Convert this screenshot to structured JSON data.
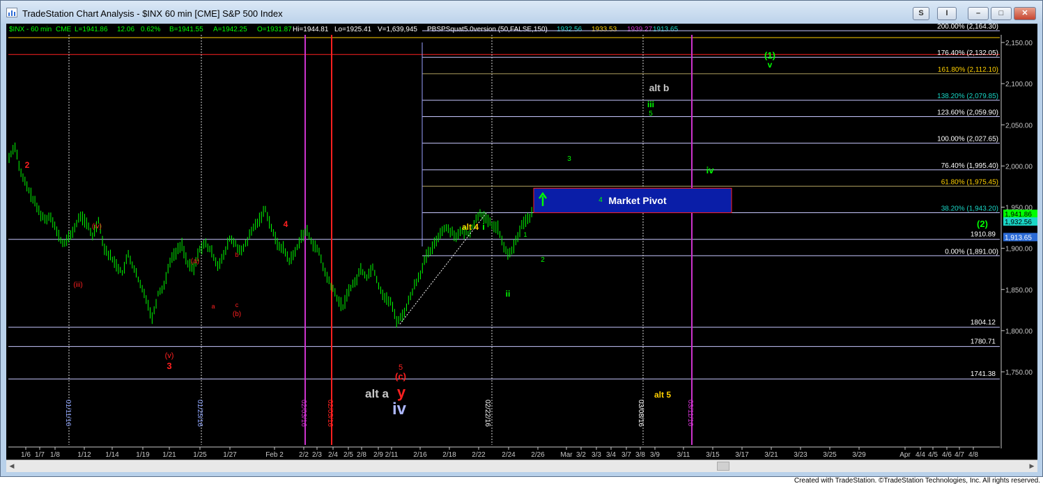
{
  "window": {
    "title": "TradeStation Chart Analysis - $INX 60 min [CME] S&P 500 Index",
    "buttons": {
      "s": "S",
      "i": "I",
      "minimize": "–",
      "maximize": "□",
      "close": "✕"
    }
  },
  "status_bar": {
    "symbol": "$INX - 60 min",
    "exchange": "CME",
    "last": "L=1941.86",
    "change": "12.06",
    "pct": "0.62%",
    "bid": "B=1941.55",
    "ask": "A=1942.25",
    "open": "O=1931.87",
    "high": "Hi=1944.81",
    "low": "Lo=1925.41",
    "volume": "V=1,639,945",
    "indicator": "PBSPSquat5.0version (50,FALSE,150)",
    "ind1": "1932.56",
    "ind2": "1933.53",
    "ind3": "1939.27",
    "ind4": "1913.65"
  },
  "colors": {
    "green": "#00ff00",
    "red": "#ff2020",
    "magenta": "#cc33cc",
    "yellow": "#ffd000",
    "teal": "#19d6c6"
  },
  "chart_data": {
    "type": "line",
    "title": "$INX 60 min [CME] S&P 500 Index",
    "price_axis_ticks": [
      "2,150.00",
      "2,100.00",
      "2,050.00",
      "2,000.00",
      "1,950.00",
      "1,900.00",
      "1,850.00",
      "1,800.00",
      "1,750.00"
    ],
    "price_axis_values": [
      2150,
      2100,
      2050,
      2000,
      1950,
      1900,
      1850,
      1800,
      1750
    ],
    "ylim": [
      1730,
      2168
    ],
    "date_labels": [
      "1/6",
      "1/7",
      "1/8",
      "1/12",
      "1/14",
      "1/19",
      "1/21",
      "1/25",
      "1/27",
      "Feb 2",
      "2/2",
      "2/3",
      "2/4",
      "2/5",
      "2/8",
      "2/9",
      "2/11",
      "2/16",
      "2/18",
      "2/22",
      "2/24",
      "2/26",
      "Mar",
      "3/2",
      "3/3",
      "3/4",
      "3/7",
      "3/8",
      "3/9",
      "3/11",
      "3/15",
      "3/17",
      "3/21",
      "3/23",
      "3/25",
      "3/29",
      "Apr",
      "4/4",
      "4/5",
      "4/6",
      "4/7",
      "4/8"
    ],
    "price_path": [
      2010,
      2025,
      1990,
      1975,
      1960,
      1945,
      1935,
      1940,
      1920,
      1905,
      1912,
      1925,
      1940,
      1930,
      1915,
      1935,
      1900,
      1890,
      1880,
      1870,
      1892,
      1875,
      1855,
      1840,
      1815,
      1845,
      1855,
      1885,
      1895,
      1905,
      1880,
      1875,
      1900,
      1905,
      1895,
      1880,
      1890,
      1912,
      1905,
      1895,
      1910,
      1925,
      1935,
      1948,
      1925,
      1905,
      1900,
      1885,
      1895,
      1915,
      1920,
      1905,
      1895,
      1870,
      1855,
      1840,
      1828,
      1850,
      1858,
      1875,
      1865,
      1878,
      1855,
      1840,
      1835,
      1812,
      1818,
      1835,
      1855,
      1870,
      1890,
      1900,
      1915,
      1925,
      1922,
      1915,
      1920,
      1918,
      1930,
      1944,
      1935,
      1928,
      1925,
      1900,
      1892,
      1908,
      1928,
      1936,
      1944
    ],
    "fib_levels": [
      {
        "label": "200.00% (2,164.30)",
        "value": 2164.3
      },
      {
        "label": "176.40% (2,132.05)",
        "value": 2132.05
      },
      {
        "label": "161.80% (2,112.10)",
        "value": 2112.1
      },
      {
        "label": "138.20% (2,079.85)",
        "value": 2079.85
      },
      {
        "label": "123.60% (2,059.90)",
        "value": 2059.9
      },
      {
        "label": "100.00% (2,027.65)",
        "value": 2027.65
      },
      {
        "label": "76.40% (1,995.40)",
        "value": 1995.4
      },
      {
        "label": "61.80% (1,975.45)",
        "value": 1975.45
      },
      {
        "label": "38.20% (1,943.20)",
        "value": 1943.2
      },
      {
        "label": "0.00% (1,891.00)",
        "value": 1891.0
      }
    ],
    "h_levels": [
      {
        "label": "1910.89",
        "value": 1910.89
      },
      {
        "label": "1804.12",
        "value": 1804.12
      },
      {
        "label": "1780.71",
        "value": 1780.71
      },
      {
        "label": "1741.38",
        "value": 1741.38
      }
    ],
    "price_tags": [
      {
        "label": "1,941.86",
        "value": 1941.86
      },
      {
        "label": "1,932.56",
        "value": 1932.56
      },
      {
        "label": "1,913.65",
        "value": 1913.65
      }
    ],
    "vertical_date_labels": [
      "01/11/16",
      "01/25/16",
      "02/03/16",
      "02/05/16",
      "02/22/16",
      "03/08/16",
      "03/11/16"
    ],
    "market_pivot": {
      "label": "Market Pivot",
      "low": 1943.2,
      "high": 1973.0
    },
    "wave_labels": [
      "2",
      "(iv)",
      "(iii)",
      "(v)",
      "3",
      "(a)",
      "a",
      "b",
      "c",
      "(b)",
      "4",
      "5",
      "(c)",
      "y",
      "iv",
      "alt  a",
      "alt 4",
      "i",
      "1",
      "2",
      "ii",
      "3",
      "4",
      "alt b",
      "iii",
      "5",
      "iv",
      "(1)",
      "v",
      "(2)",
      "alt 5"
    ]
  },
  "footer": "Created with TradeStation. ©TradeStation Technologies, Inc. All rights reserved."
}
